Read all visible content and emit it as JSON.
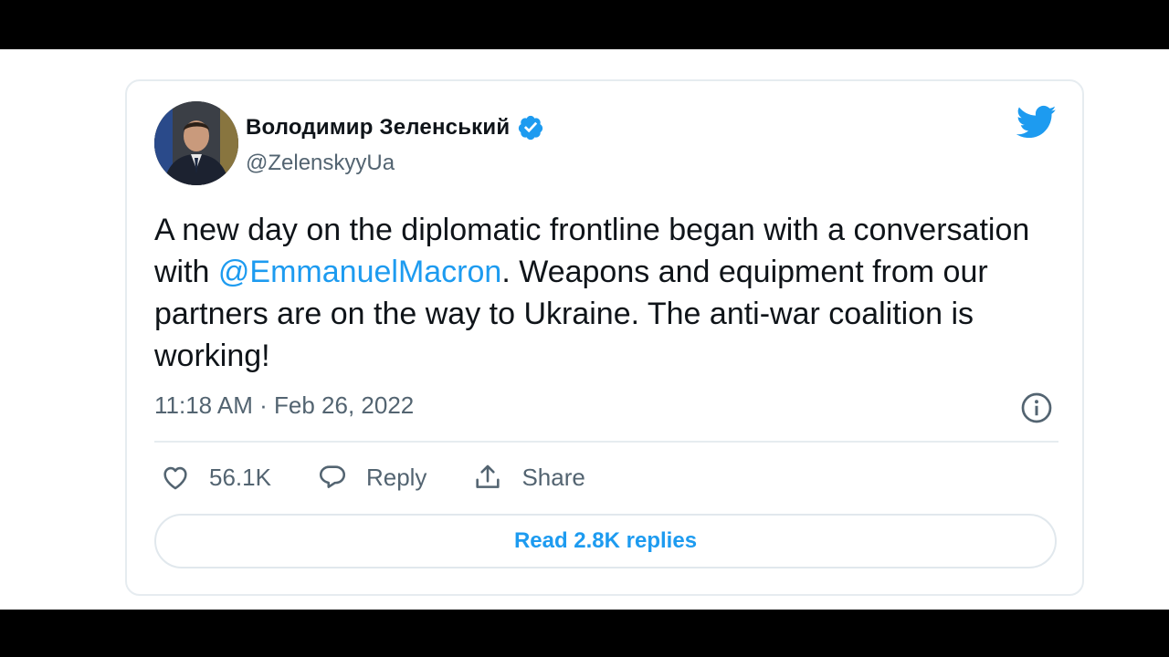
{
  "tweet": {
    "author_name": "Володимир Зеленський",
    "handle": "@ZelenskyyUa",
    "text_before_mention": "A new day on the diplomatic frontline began with a conversation with ",
    "mention": "@EmmanuelMacron",
    "text_after_mention": ". Weapons and equipment from our partners are on the way to Ukraine. The anti-war coalition is working!",
    "timestamp": "11:18 AM · Feb 26, 2022"
  },
  "actions": {
    "likes_count": "56.1K",
    "reply_label": "Reply",
    "share_label": "Share"
  },
  "replies_button_label": "Read 2.8K replies",
  "icons": {
    "verified": "verified-badge-icon",
    "brand": "twitter-bird-icon",
    "info": "info-icon",
    "like": "heart-icon",
    "reply": "comment-bubble-icon",
    "share": "share-upload-icon"
  },
  "colors": {
    "accent": "#1d9bf0",
    "text_primary": "#0f1419",
    "text_secondary": "#536471",
    "border": "#e6ecf0"
  }
}
